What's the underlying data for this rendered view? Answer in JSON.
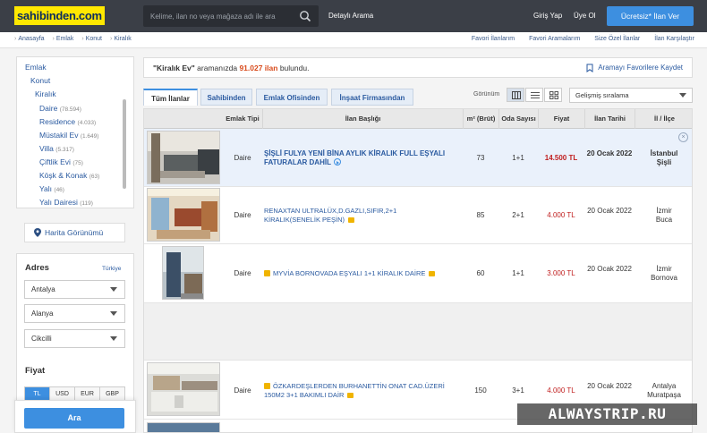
{
  "header": {
    "logo": "sahibinden.com",
    "search_placeholder": "Kelime, ilan no veya mağaza adı ile ara",
    "detailed_search": "Detaylı Arama",
    "login": "Giriş Yap",
    "register": "Üye Ol",
    "post_ad": "Ücretsiz* İlan Ver"
  },
  "breadcrumb": [
    "Anasayfa",
    "Emlak",
    "Konut",
    "Kiralık"
  ],
  "top_links": [
    "Favori İlanlarım",
    "Favori Aramalarım",
    "Size Özel İlanlar",
    "İlan Karşılaştır"
  ],
  "categories": {
    "root": "Emlak",
    "level1": "Konut",
    "level2": "Kiralık",
    "items": [
      {
        "label": "Daire",
        "count": "(78.594)"
      },
      {
        "label": "Residence",
        "count": "(4.033)"
      },
      {
        "label": "Müstakil Ev",
        "count": "(1.649)"
      },
      {
        "label": "Villa",
        "count": "(5.317)"
      },
      {
        "label": "Çiftlik Evi",
        "count": "(75)"
      },
      {
        "label": "Köşk & Konak",
        "count": "(63)"
      },
      {
        "label": "Yalı",
        "count": "(46)"
      },
      {
        "label": "Yalı Dairesi",
        "count": "(119)"
      }
    ]
  },
  "map_view": "Harita Görünümü",
  "address": {
    "label": "Adres",
    "country": "Türkiye",
    "city": "Antalya",
    "district": "Alanya",
    "neighborhood": "Cikcilli"
  },
  "price": {
    "label": "Fiyat",
    "currencies": [
      "TL",
      "USD",
      "EUR",
      "GBP"
    ],
    "selected": "TL"
  },
  "search_button": "Ara",
  "results": {
    "query": "\"Kiralık Ev\"",
    "middle": " aramanızda ",
    "count": "91.027 ilan",
    "suffix": " bulundu.",
    "save_search": "Aramayı Favorilere Kaydet"
  },
  "tabs": [
    "Tüm İlanlar",
    "Sahibinden",
    "Emlak Ofisinden",
    "İnşaat Firmasından"
  ],
  "view_label": "Görünüm",
  "sort": "Gelişmiş sıralama",
  "columns": [
    "Emlak Tipi",
    "İlan Başlığı",
    "m² (Brüt)",
    "Oda Sayısı",
    "Fiyat",
    "İlan Tarihi",
    "İl / İlçe"
  ],
  "listings": [
    {
      "type": "Daire",
      "title": "ŞİŞLİ FULYA YENİ BİNA AYLIK KİRALIK FULL EŞYALI FATURALAR DAHİL",
      "m2": "73",
      "rooms": "1+1",
      "price": "14.500 TL",
      "date": "20 Ocak 2022",
      "city": "İstanbul",
      "district": "Şişli",
      "close": "×"
    },
    {
      "type": "Daire",
      "title": "RENAXTAN ULTRALÜX,D.GAZLI,SIFIR,2+1 KİRALIK(SENELİK PEŞİN)",
      "m2": "85",
      "rooms": "2+1",
      "price": "4.000 TL",
      "date": "20 Ocak 2022",
      "city": "İzmir",
      "district": "Buca"
    },
    {
      "type": "Daire",
      "title": "MYVİA BORNOVADA EŞYALI 1+1 KİRALIK DAİRE",
      "m2": "60",
      "rooms": "1+1",
      "price": "3.000 TL",
      "date": "20 Ocak 2022",
      "city": "İzmir",
      "district": "Bornova"
    },
    {
      "type": "Daire",
      "title": "ÖZKARDEŞLERDEN BURHANETTİN ONAT CAD.ÜZERİ 150m2 3+1 BAKIMLI DAİR",
      "m2": "150",
      "rooms": "3+1",
      "price": "4.000 TL",
      "date": "20 Ocak 2022",
      "city": "Antalya",
      "district": "Muratpaşa"
    }
  ],
  "watermark": "ALWAYSTRIP.RU",
  "colors": {
    "header_bg": "#3b3f47",
    "logo_yellow": "#ffe800",
    "accent_blue": "#3d8fe0",
    "price_red": "#c01e1e",
    "link_blue": "#2a5aa0"
  }
}
